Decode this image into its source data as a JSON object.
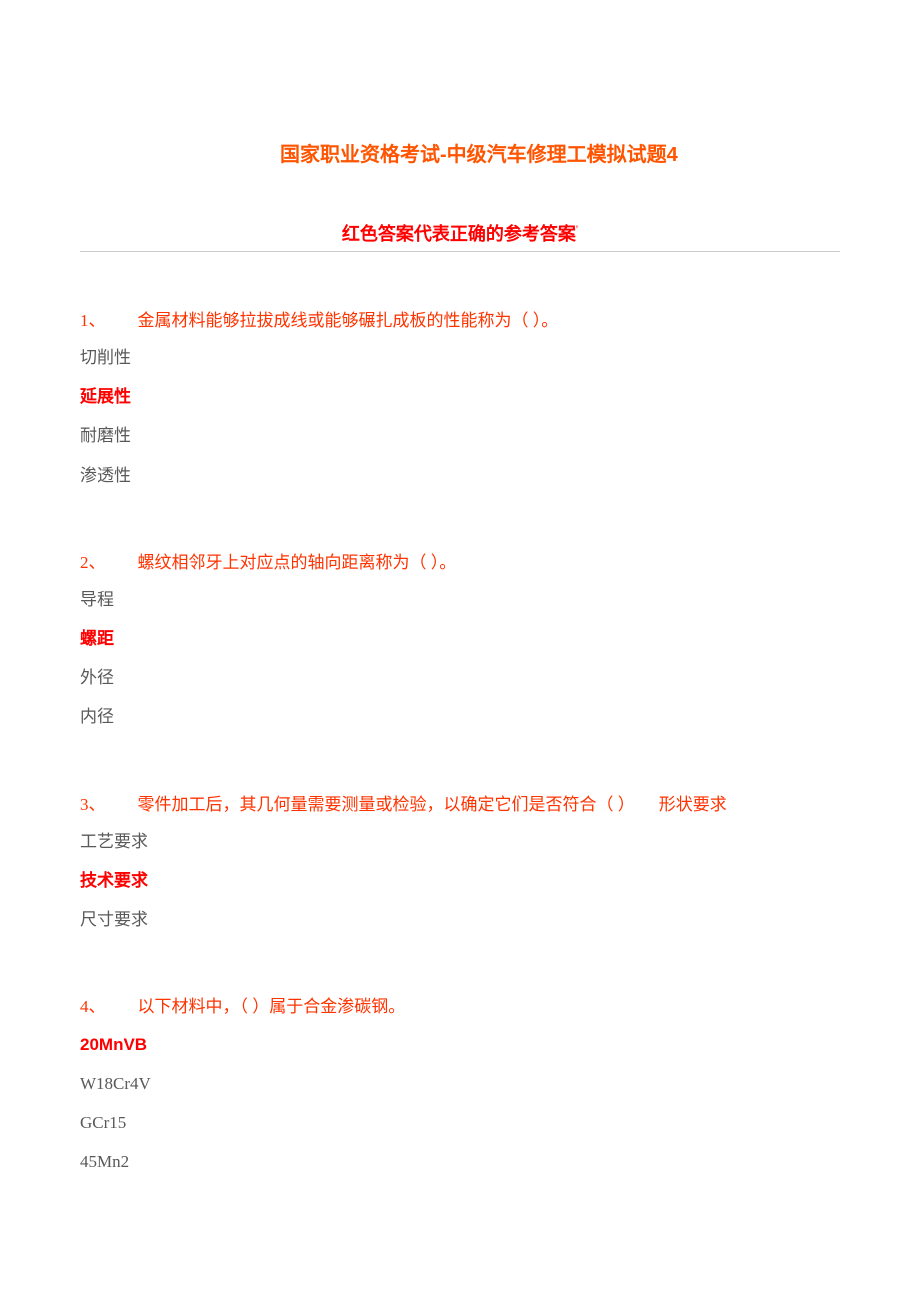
{
  "title": "国家职业资格考试-中级汽车修理工模拟试题4",
  "subtitle": "红色答案代表正确的参考答案",
  "questions": [
    {
      "num": "1、",
      "text": "金属材料能够拉拔成线或能够碾扎成板的性能称为（ ）。",
      "trail": "",
      "options": [
        {
          "text": "切削性",
          "correct": false
        },
        {
          "text": "延展性",
          "correct": true
        },
        {
          "text": "耐磨性",
          "correct": false
        },
        {
          "text": "渗透性",
          "correct": false
        }
      ]
    },
    {
      "num": "2、",
      "text": "螺纹相邻牙上对应点的轴向距离称为（ ）。",
      "trail": "",
      "options": [
        {
          "text": "导程",
          "correct": false
        },
        {
          "text": "螺距",
          "correct": true
        },
        {
          "text": "外径",
          "correct": false
        },
        {
          "text": "内径",
          "correct": false
        }
      ]
    },
    {
      "num": "3、",
      "text": "零件加工后，其几何量需要测量或检验，以确定它们是否符合（ ）",
      "trail": "形状要求",
      "options": [
        {
          "text": "工艺要求",
          "correct": false
        },
        {
          "text": "技术要求",
          "correct": true
        },
        {
          "text": "尺寸要求",
          "correct": false
        }
      ]
    },
    {
      "num": "4、",
      "text": "以下材料中，（ ）属于合金渗碳钢。",
      "trail": "",
      "options": [
        {
          "text": "20MnVB",
          "correct": true
        },
        {
          "text": "W18Cr4V",
          "correct": false
        },
        {
          "text": "GCr15",
          "correct": false
        },
        {
          "text": "45Mn2",
          "correct": false
        }
      ]
    }
  ]
}
